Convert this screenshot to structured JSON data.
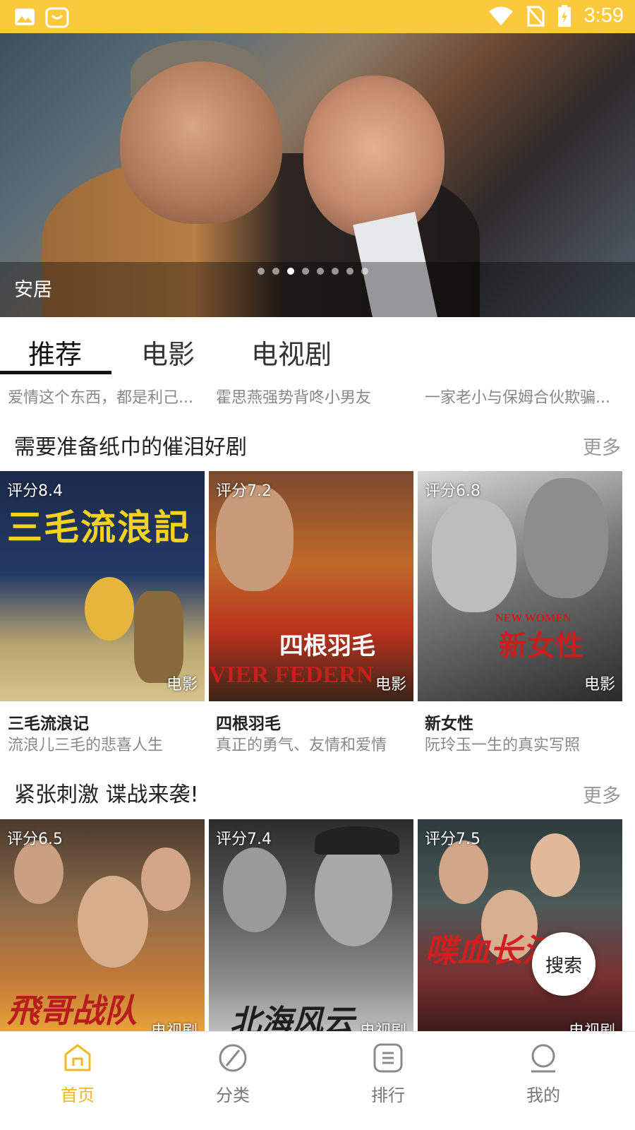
{
  "status_bar": {
    "time": "3:59"
  },
  "banner": {
    "caption": "安居",
    "dot_count": 8,
    "active_dot": 2
  },
  "tabs": [
    {
      "label": "推荐",
      "active": true
    },
    {
      "label": "电影",
      "active": false
    },
    {
      "label": "电视剧",
      "active": false
    }
  ],
  "peek_row": [
    {
      "subtitle": "爱情这个东西，都是利己..."
    },
    {
      "subtitle": "霍思燕强势背咚小男友"
    },
    {
      "subtitle": "一家老小与保姆合伙欺骗..."
    }
  ],
  "section1": {
    "title": "需要准备纸巾的催泪好剧",
    "more": "更多",
    "items": [
      {
        "rating": "评分8.4",
        "kind": "电影",
        "title": "三毛流浪记",
        "subtitle": "流浪儿三毛的悲喜人生",
        "art": "三毛流浪記"
      },
      {
        "rating": "评分7.2",
        "kind": "电影",
        "title": "四根羽毛",
        "subtitle": "真正的勇气、友情和爱情",
        "art": "四根羽毛",
        "art2": "VIER FEDERN"
      },
      {
        "rating": "评分6.8",
        "kind": "电影",
        "title": "新女性",
        "subtitle": "阮玲玉一生的真实写照",
        "art": "新女性",
        "art2": "NEW WOMEN"
      }
    ]
  },
  "section2": {
    "title": "紧张刺激   谍战来袭!",
    "more": "更多",
    "items": [
      {
        "rating": "评分6.5",
        "kind": "电视剧",
        "art": "飛哥战队"
      },
      {
        "rating": "评分7.4",
        "kind": "电视剧",
        "art": "北海风云"
      },
      {
        "rating": "评分7.5",
        "kind": "电视剧",
        "art": "喋血长江"
      }
    ]
  },
  "fab": {
    "label": "搜索"
  },
  "bottom_nav": [
    {
      "label": "首页",
      "icon": "home-icon",
      "active": true
    },
    {
      "label": "分类",
      "icon": "category-icon",
      "active": false
    },
    {
      "label": "排行",
      "icon": "ranking-icon",
      "active": false
    },
    {
      "label": "我的",
      "icon": "profile-icon",
      "active": false
    }
  ],
  "colors": {
    "accent": "#fbc93c",
    "active_nav": "#f1b824"
  }
}
